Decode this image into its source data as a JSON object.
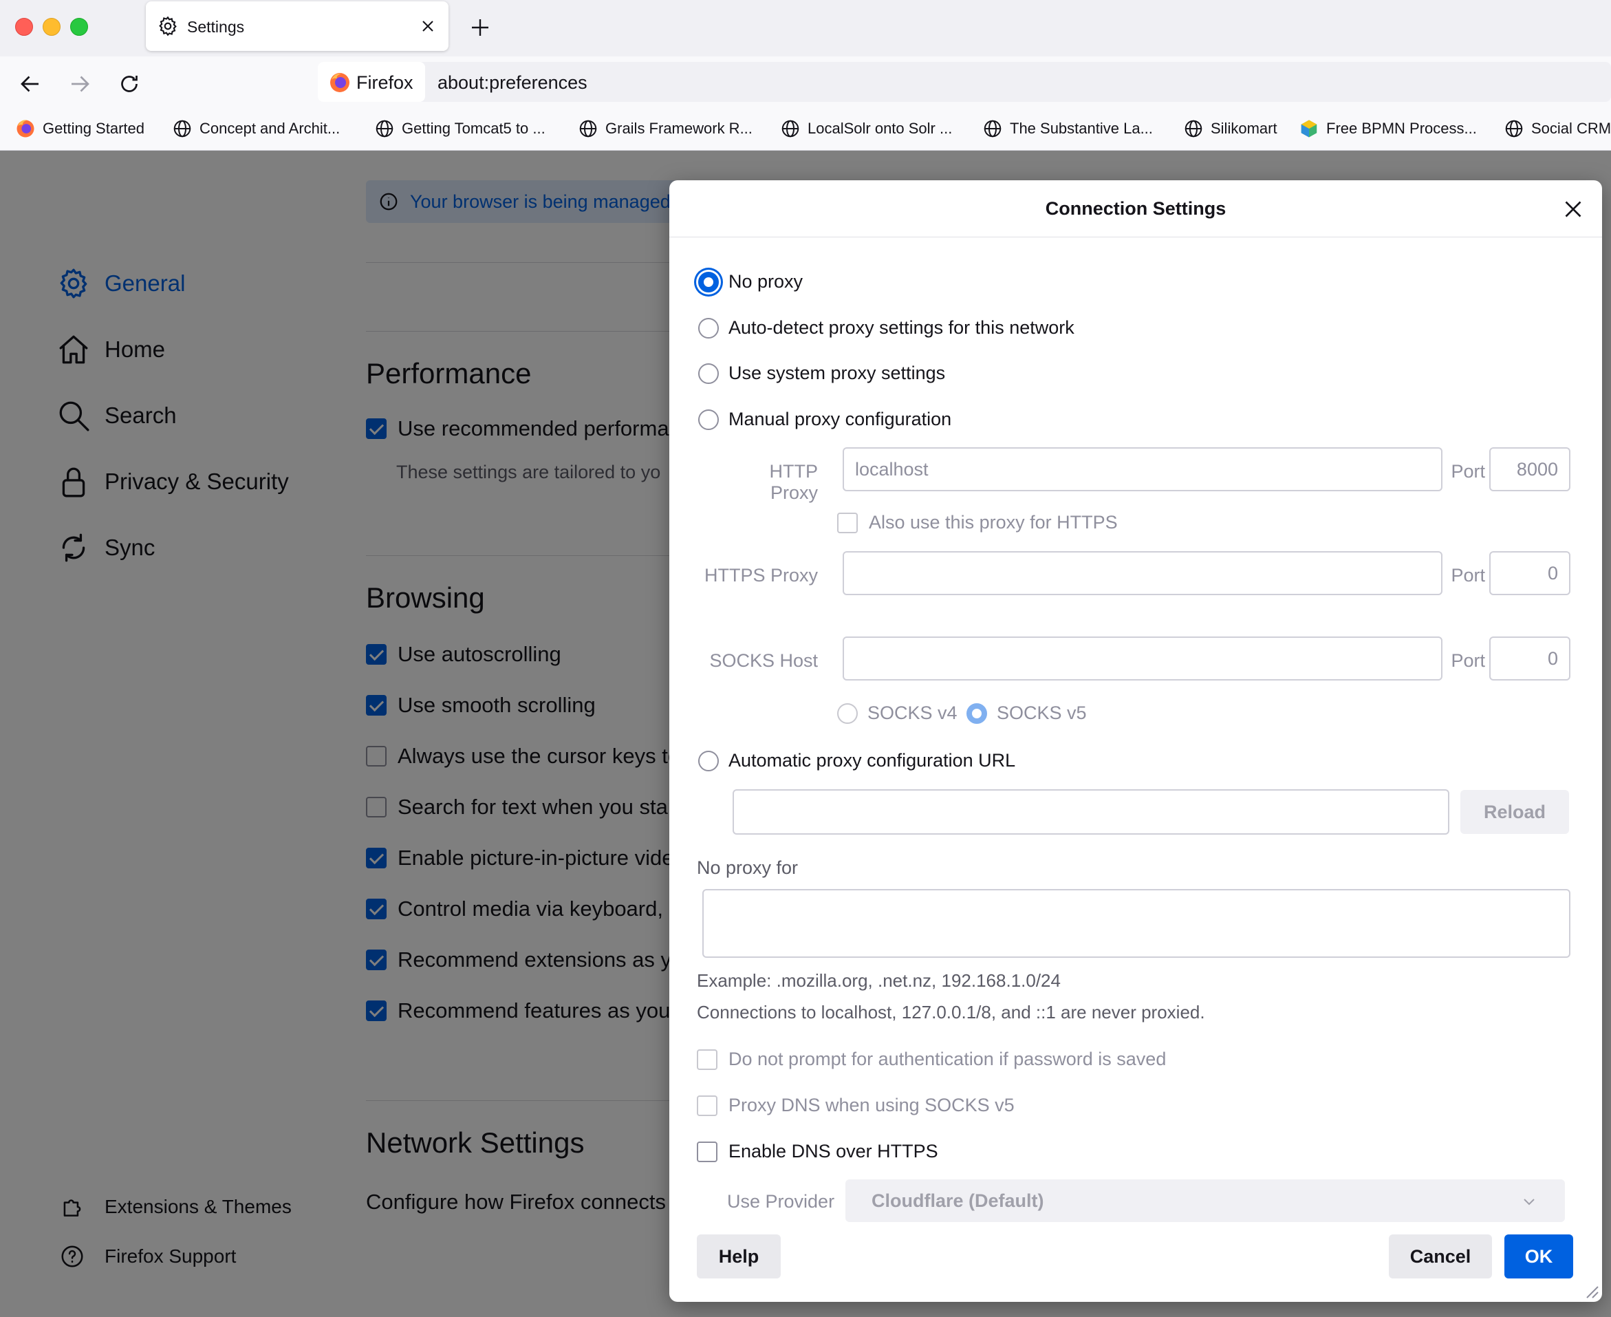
{
  "browser": {
    "tab_title": "Settings",
    "identity_label": "Firefox",
    "url": "about:preferences",
    "bookmarks": [
      {
        "label": "Getting Started",
        "icon": "firefox-icon"
      },
      {
        "label": "Concept and Archit...",
        "icon": "globe-icon"
      },
      {
        "label": "Getting Tomcat5 to ...",
        "icon": "globe-icon"
      },
      {
        "label": "Grails Framework R...",
        "icon": "globe-icon"
      },
      {
        "label": "LocalSolr onto Solr ...",
        "icon": "globe-icon"
      },
      {
        "label": "The Substantive La...",
        "icon": "globe-icon"
      },
      {
        "label": "Silikomart",
        "icon": "globe-icon"
      },
      {
        "label": "Free BPMN Process...",
        "icon": "bpmn-icon"
      },
      {
        "label": "Social CRM",
        "icon": "globe-icon"
      }
    ]
  },
  "settings": {
    "sidebar": [
      {
        "label": "General",
        "icon": "gear-icon",
        "active": true
      },
      {
        "label": "Home",
        "icon": "home-icon"
      },
      {
        "label": "Search",
        "icon": "search-icon"
      },
      {
        "label": "Privacy & Security",
        "icon": "lock-icon"
      },
      {
        "label": "Sync",
        "icon": "sync-icon"
      }
    ],
    "sidebar_footer": [
      {
        "label": "Extensions & Themes",
        "icon": "puzzle-icon"
      },
      {
        "label": "Firefox Support",
        "icon": "help-icon"
      }
    ],
    "notice": "Your browser is being managed",
    "performance": {
      "heading": "Performance",
      "recommended": "Use recommended performa",
      "recommended_note": "These settings are tailored to yo"
    },
    "browsing": {
      "heading": "Browsing",
      "options": [
        {
          "label": "Use autoscrolling",
          "checked": true
        },
        {
          "label": "Use smooth scrolling",
          "checked": true
        },
        {
          "label": "Always use the cursor keys to",
          "checked": false
        },
        {
          "label": "Search for text when you star",
          "checked": false
        },
        {
          "label": "Enable picture-in-picture vide",
          "checked": true
        },
        {
          "label": "Control media via keyboard, h",
          "checked": true
        },
        {
          "label": "Recommend extensions as yo",
          "checked": true
        },
        {
          "label": "Recommend features as you",
          "checked": true
        }
      ]
    },
    "network": {
      "heading": "Network Settings",
      "description": "Configure how Firefox connects"
    }
  },
  "dialog": {
    "title": "Connection Settings",
    "proxy_options": {
      "no_proxy": "No proxy",
      "auto_detect": "Auto-detect proxy settings for this network",
      "system": "Use system proxy settings",
      "manual": "Manual proxy configuration",
      "auto_url": "Automatic proxy configuration URL"
    },
    "selected": "No proxy",
    "http": {
      "label": "HTTP Proxy",
      "placeholder": "localhost",
      "port_label": "Port",
      "port_placeholder": "8000"
    },
    "also_https": "Also use this proxy for HTTPS",
    "https": {
      "label": "HTTPS Proxy",
      "value": "",
      "port_label": "Port",
      "port_placeholder": "0"
    },
    "socks": {
      "label": "SOCKS Host",
      "value": "",
      "port_label": "Port",
      "port_placeholder": "0",
      "v4": "SOCKS v4",
      "v5": "SOCKS v5",
      "selected_version": "SOCKS v5"
    },
    "reload_label": "Reload",
    "no_proxy_for_label": "No proxy for",
    "example": "Example: .mozilla.org, .net.nz, 192.168.1.0/24",
    "never_proxied": "Connections to localhost, 127.0.0.1/8, and ::1 are never proxied.",
    "no_auth_prompt": "Do not prompt for authentication if password is saved",
    "proxy_dns": "Proxy DNS when using SOCKS v5",
    "dns_over_https": "Enable DNS over HTTPS",
    "use_provider_label": "Use Provider",
    "provider_selected": "Cloudflare (Default)",
    "help_label": "Help",
    "cancel_label": "Cancel",
    "ok_label": "OK",
    "accent_color": "#0061e0"
  }
}
